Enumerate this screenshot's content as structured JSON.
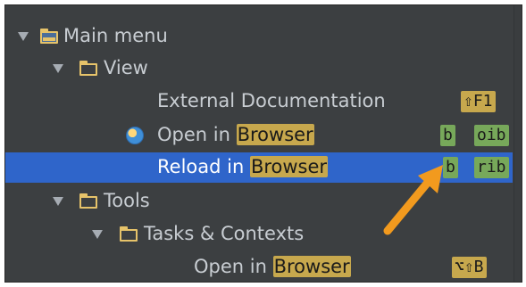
{
  "tree": {
    "main_menu": {
      "label": "Main menu"
    },
    "view": {
      "label": "View"
    },
    "external_docs": {
      "label": "External Documentation",
      "shortcut": "⇧F1"
    },
    "open_in_browser": {
      "label_prefix": "Open in ",
      "label_highlight": "Browser",
      "shortcut1": "b",
      "shortcut2": "oib"
    },
    "reload_in_browser": {
      "label_prefix": "Reload in ",
      "label_highlight": "Browser",
      "shortcut1": "b",
      "shortcut2": "rib"
    },
    "tools": {
      "label": "Tools"
    },
    "tasks_contexts": {
      "label": "Tasks & Contexts"
    },
    "open_in_browser_2": {
      "label_prefix": "Open in ",
      "label_highlight": "Browser",
      "shortcut": "⌥⇧B"
    }
  },
  "colors": {
    "background": "#3c3f41",
    "selection": "#2f65ca",
    "highlight": "#c7a84d",
    "badge_green": "#77a85a",
    "callout_arrow": "#f29a1e"
  },
  "icons": [
    "chevron-down-icon",
    "folder-icon",
    "globe-icon",
    "callout-arrow-icon"
  ]
}
